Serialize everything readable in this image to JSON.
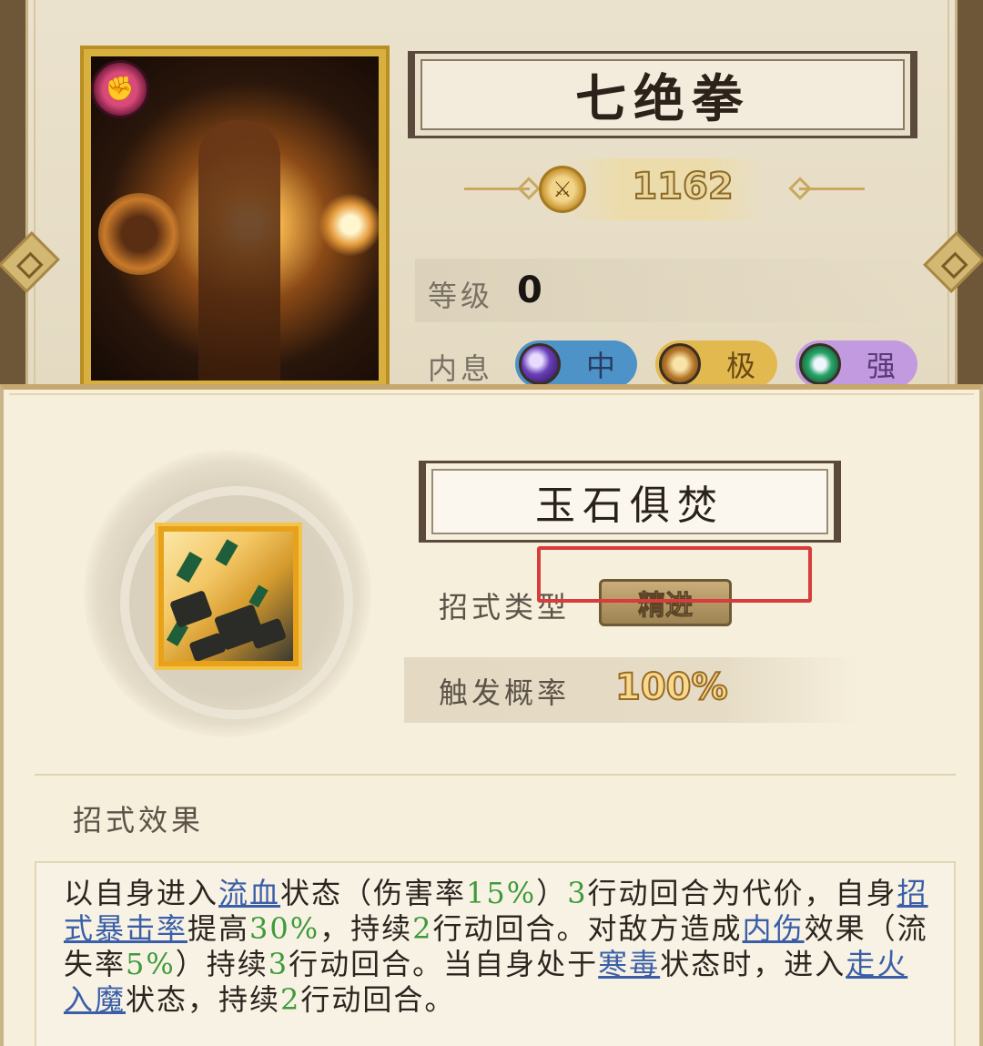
{
  "top_card": {
    "title": "七绝拳",
    "power": "1162",
    "level_label": "等级",
    "level_value": "0",
    "neixi_label": "内息",
    "neixi": [
      {
        "label": "中",
        "color": "#4d93c8"
      },
      {
        "label": "极",
        "color": "#e2b94e"
      },
      {
        "label": "强",
        "color": "#c29adf"
      }
    ],
    "badge_icon": "fist-icon",
    "power_icon": "sword-icon"
  },
  "skill": {
    "title": "玉石俱焚",
    "type_label": "招式类型",
    "type_value": "精进",
    "rate_label": "触发概率",
    "rate_value": "100%",
    "icon": "shattered-rock-skill-icon"
  },
  "effect": {
    "heading": "招式效果",
    "segments": [
      {
        "t": "以自身进入",
        "c": "text"
      },
      {
        "t": "流血",
        "c": "kw"
      },
      {
        "t": "状态（伤害率",
        "c": "text"
      },
      {
        "t": "15%",
        "c": "num"
      },
      {
        "t": "）",
        "c": "text"
      },
      {
        "t": "3",
        "c": "num"
      },
      {
        "t": "行动回合为代价，自身",
        "c": "text"
      },
      {
        "t": "招式暴击率",
        "c": "kw"
      },
      {
        "t": "提高",
        "c": "text"
      },
      {
        "t": "30%",
        "c": "num"
      },
      {
        "t": "，持续",
        "c": "text"
      },
      {
        "t": "2",
        "c": "num"
      },
      {
        "t": "行动回合。对敌方造成",
        "c": "text"
      },
      {
        "t": "内伤",
        "c": "kw"
      },
      {
        "t": "效果（流失率",
        "c": "text"
      },
      {
        "t": "5%",
        "c": "num"
      },
      {
        "t": "）持续",
        "c": "text"
      },
      {
        "t": "3",
        "c": "num"
      },
      {
        "t": "行动回合。当自身处于",
        "c": "text"
      },
      {
        "t": "寒毒",
        "c": "kw"
      },
      {
        "t": "状态时，进入",
        "c": "text"
      },
      {
        "t": "走火入魔",
        "c": "kw"
      },
      {
        "t": "状态，持续",
        "c": "text"
      },
      {
        "t": "2",
        "c": "num"
      },
      {
        "t": "行动回合。",
        "c": "text"
      }
    ],
    "highlight_color": "#d83c3c"
  }
}
